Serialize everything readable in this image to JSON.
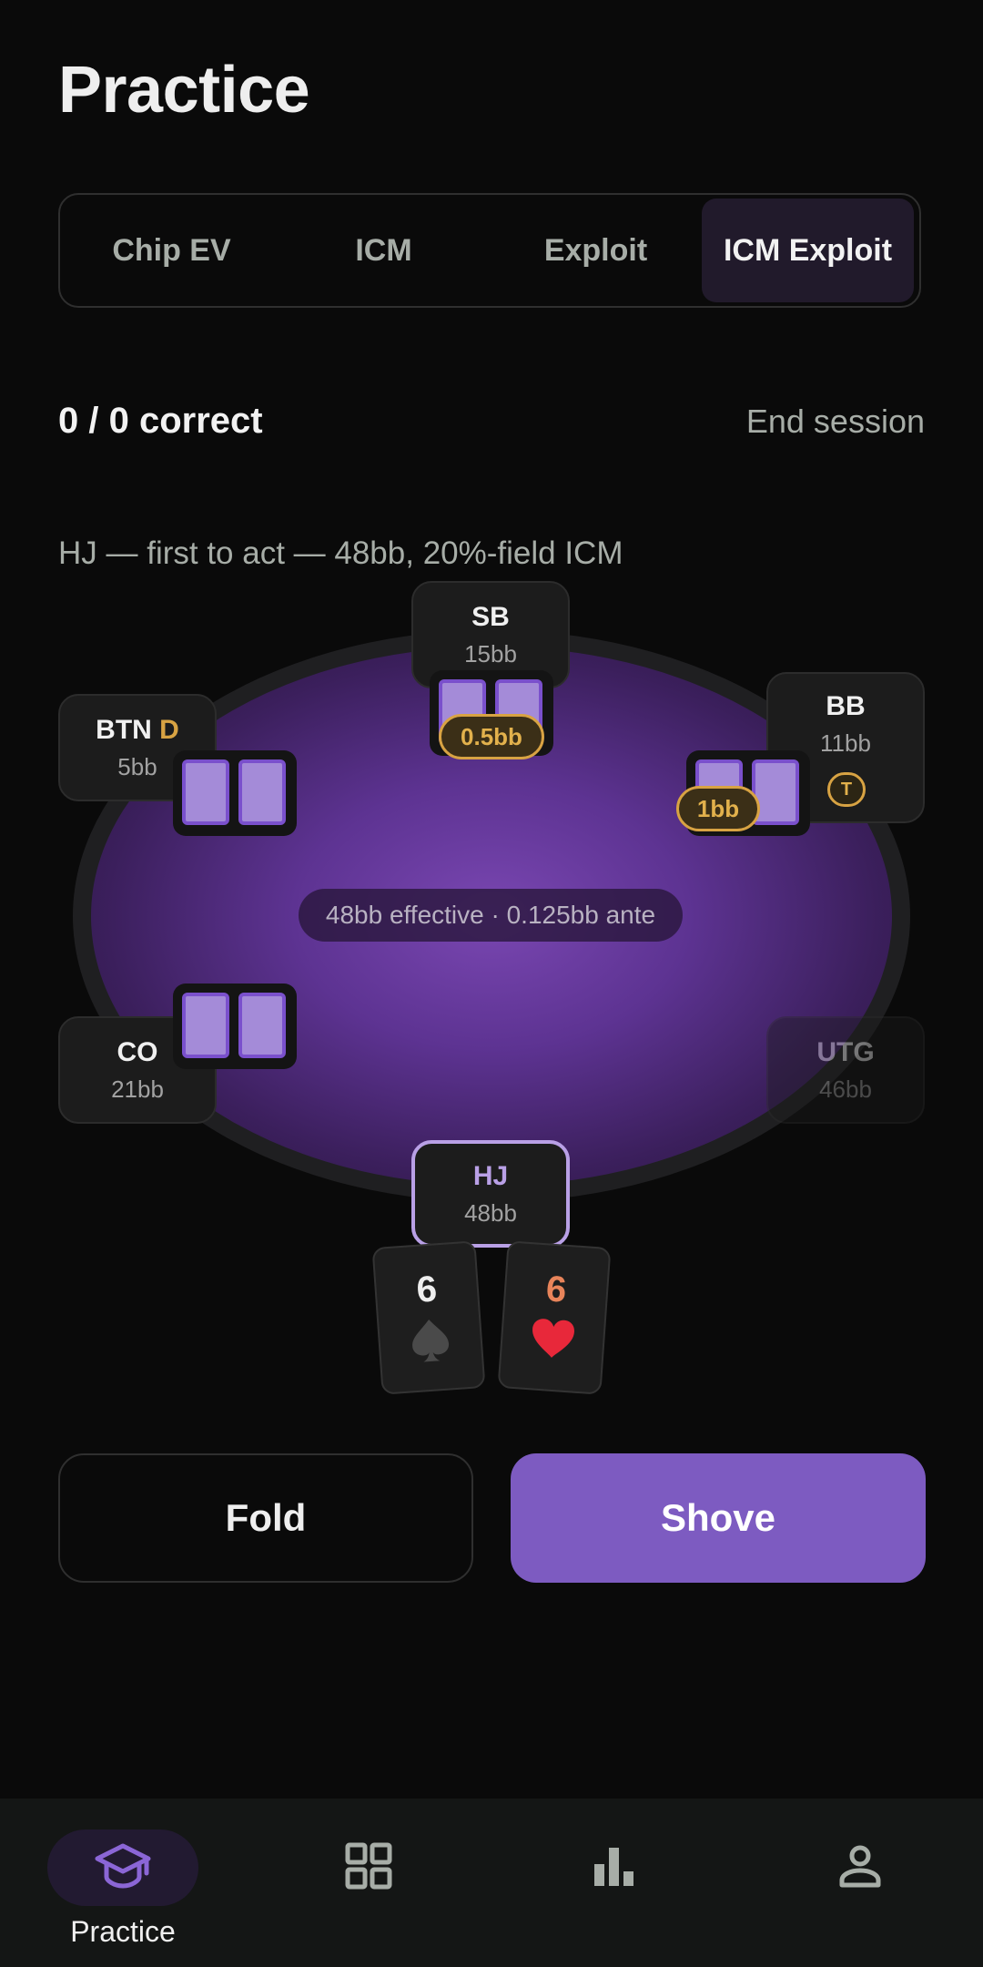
{
  "page": {
    "title": "Practice"
  },
  "tabs": [
    {
      "label": "Chip EV",
      "active": false
    },
    {
      "label": "ICM",
      "active": false
    },
    {
      "label": "Exploit",
      "active": false
    },
    {
      "label": "ICM Exploit",
      "active": true
    }
  ],
  "session": {
    "score": "0 / 0 correct",
    "end_label": "End session"
  },
  "scenario": {
    "text": "HJ — first to act — 48bb, 20%-field ICM"
  },
  "table": {
    "center_info": "48bb effective · 0.125bb ante",
    "seats": {
      "sb": {
        "name": "SB",
        "stack": "15bb",
        "bet": "0.5bb"
      },
      "bb": {
        "name": "BB",
        "stack": "11bb",
        "bet": "1bb",
        "badge": "T"
      },
      "btn": {
        "name": "BTN",
        "dealer": "D",
        "stack": "5bb"
      },
      "co": {
        "name": "CO",
        "stack": "21bb"
      },
      "utg": {
        "name": "UTG",
        "stack": "46bb"
      },
      "hj": {
        "name": "HJ",
        "stack": "48bb"
      }
    },
    "hero_cards": [
      {
        "rank": "6",
        "suit": "spade",
        "suit_glyph": "♠",
        "rank_color": "#eeeeee",
        "suit_color": "#4a4a4a"
      },
      {
        "rank": "6",
        "suit": "heart",
        "suit_glyph": "♥",
        "rank_color": "#e8845a",
        "suit_color": "#e8283a"
      }
    ]
  },
  "actions": {
    "fold": "Fold",
    "shove": "Shove"
  },
  "colors": {
    "accent": "#7d5bc1",
    "gold": "#d8a343",
    "background": "#0a0a0a"
  },
  "nav": [
    {
      "label": "Practice",
      "icon": "graduation-cap-icon",
      "active": true
    },
    {
      "label": "",
      "icon": "grid-icon",
      "active": false
    },
    {
      "label": "",
      "icon": "bar-chart-icon",
      "active": false
    },
    {
      "label": "",
      "icon": "person-icon",
      "active": false
    }
  ]
}
